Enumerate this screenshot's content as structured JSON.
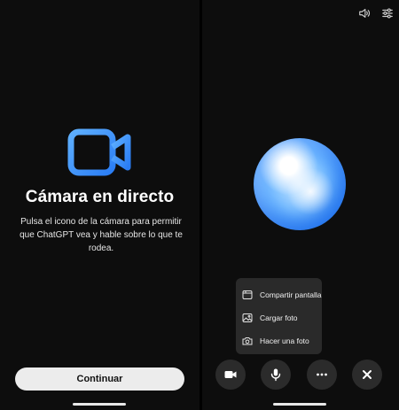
{
  "camera_intro": {
    "title": "Cámara en directo",
    "description": "Pulsa el icono de la cámara para permitir que ChatGPT vea y hable sobre lo que te rodea.",
    "continue_label": "Continuar"
  },
  "share_menu": {
    "items": [
      {
        "label": "Compartir pantalla",
        "icon": "screen-share-icon"
      },
      {
        "label": "Cargar foto",
        "icon": "photo-icon"
      },
      {
        "label": "Hacer una foto",
        "icon": "camera-icon"
      }
    ]
  },
  "top_bar": {
    "icons": [
      "speaker-icon",
      "settings-sliders-icon"
    ]
  },
  "controls": {
    "icons": [
      "video-camera-icon",
      "microphone-icon",
      "more-icon",
      "close-icon"
    ]
  },
  "colors": {
    "accent": "#3a8dff",
    "background": "#0d0d0d",
    "button": "#2b2b2b",
    "menu": "#2a2a2a"
  }
}
